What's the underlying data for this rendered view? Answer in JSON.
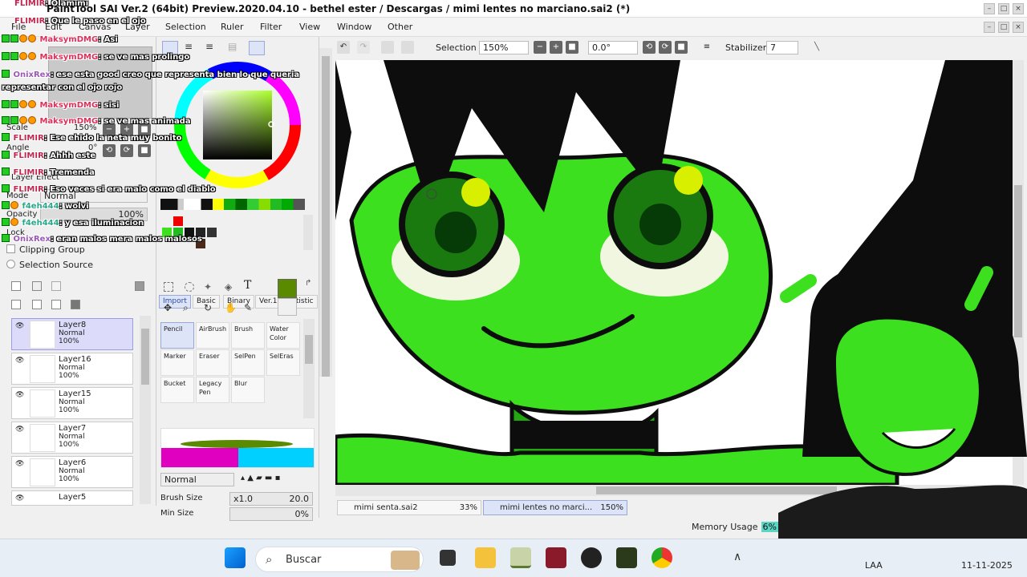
{
  "window": {
    "title": "PaintTool SAI Ver.2 (64bit) Preview.2020.04.10 - bethel ester / Descargas / mimi lentes no marciano.sai2 (*)"
  },
  "menu": [
    "File",
    "Edit",
    "Canvas",
    "Layer",
    "Selection",
    "Ruler",
    "Filter",
    "View",
    "Window",
    "Other"
  ],
  "toolbar": {
    "selection_label": "Selection",
    "zoom": "150%",
    "angle": "0.0°",
    "stabilizer_label": "Stabilizer",
    "stabilizer_value": "7"
  },
  "navigator": {
    "scale_label": "Scale",
    "scale_value": "150%",
    "angle_label": "Angle",
    "angle_value": "0°"
  },
  "layer_props": {
    "effect_label": "Layer Effect",
    "mode_label": "Mode",
    "mode_value": "Normal",
    "opacity_label": "Opacity",
    "opacity_value": "100%",
    "lock_label": "Lock",
    "clipping_label": "Clipping Group",
    "selsource_label": "Selection Source"
  },
  "layers": [
    {
      "name": "Layer8",
      "mode": "Normal",
      "opacity": "100%"
    },
    {
      "name": "Layer16",
      "mode": "Normal",
      "opacity": "100%"
    },
    {
      "name": "Layer15",
      "mode": "Normal",
      "opacity": "100%"
    },
    {
      "name": "Layer7",
      "mode": "Normal",
      "opacity": "100%"
    },
    {
      "name": "Layer6",
      "mode": "Normal",
      "opacity": "100%"
    },
    {
      "name": "Layer5"
    }
  ],
  "tool_tabs": [
    "Import",
    "Basic",
    "Binary",
    "Ver.1",
    "Artistic"
  ],
  "tools": [
    "Pencil",
    "AirBrush",
    "Brush",
    "Water Color",
    "Marker",
    "Eraser",
    "SelPen",
    "SelEras",
    "Bucket",
    "Legacy Pen",
    "Blur"
  ],
  "brush": {
    "mode": "Normal",
    "size_label": "Brush Size",
    "size_mult": "x1.0",
    "size_value": "20.0",
    "min_label": "Min Size",
    "min_value": "0%"
  },
  "colors": {
    "main": "#5a8a00",
    "canvas_green": "#3de01f",
    "accent": "#4a6cd4"
  },
  "files": [
    {
      "name": "mimi senta.sai2",
      "zoom": "33%"
    },
    {
      "name": "mimi lentes no marci...",
      "zoom": "150%"
    }
  ],
  "memory": {
    "label": "Memory Usage",
    "value": "6% (7%)"
  },
  "chat": [
    {
      "user": "FLIMIR",
      "msg": ": Olamimi"
    },
    {
      "user": "FLIMIR",
      "msg": ": Que le paso en el ojo"
    },
    {
      "user": "MaksymDMG",
      "msg": ": Asi"
    },
    {
      "user": "MaksymDMG",
      "msg": ": se ve mas prolingo"
    },
    {
      "user": "OnixRex",
      "msg": ": ese esta good creo que representa bien lo que queria representar con el ojo rojo"
    },
    {
      "user": "MaksymDMG",
      "msg": ": sisi"
    },
    {
      "user": "MaksymDMG",
      "msg": ": se ve mas animada"
    },
    {
      "user": "FLIMIR",
      "msg": ": Ese ehido la neta muy bonito"
    },
    {
      "user": "FLIMIR",
      "msg": ": Ahhh este"
    },
    {
      "user": "FLIMIR",
      "msg": ": Tremenda"
    },
    {
      "user": "FLIMIR",
      "msg": ": Eso veces si era malo como el diablo"
    },
    {
      "user": "f4eh444",
      "msg": ": wolvi"
    },
    {
      "user": "f4eh444",
      "msg": ": y esa iluminacion"
    },
    {
      "user": "OnixRex",
      "msg": ": eran malos mera malos malosos"
    }
  ],
  "taskbar": {
    "search_placeholder": "Buscar",
    "lang": "LAA",
    "date": "11-11-2025"
  }
}
